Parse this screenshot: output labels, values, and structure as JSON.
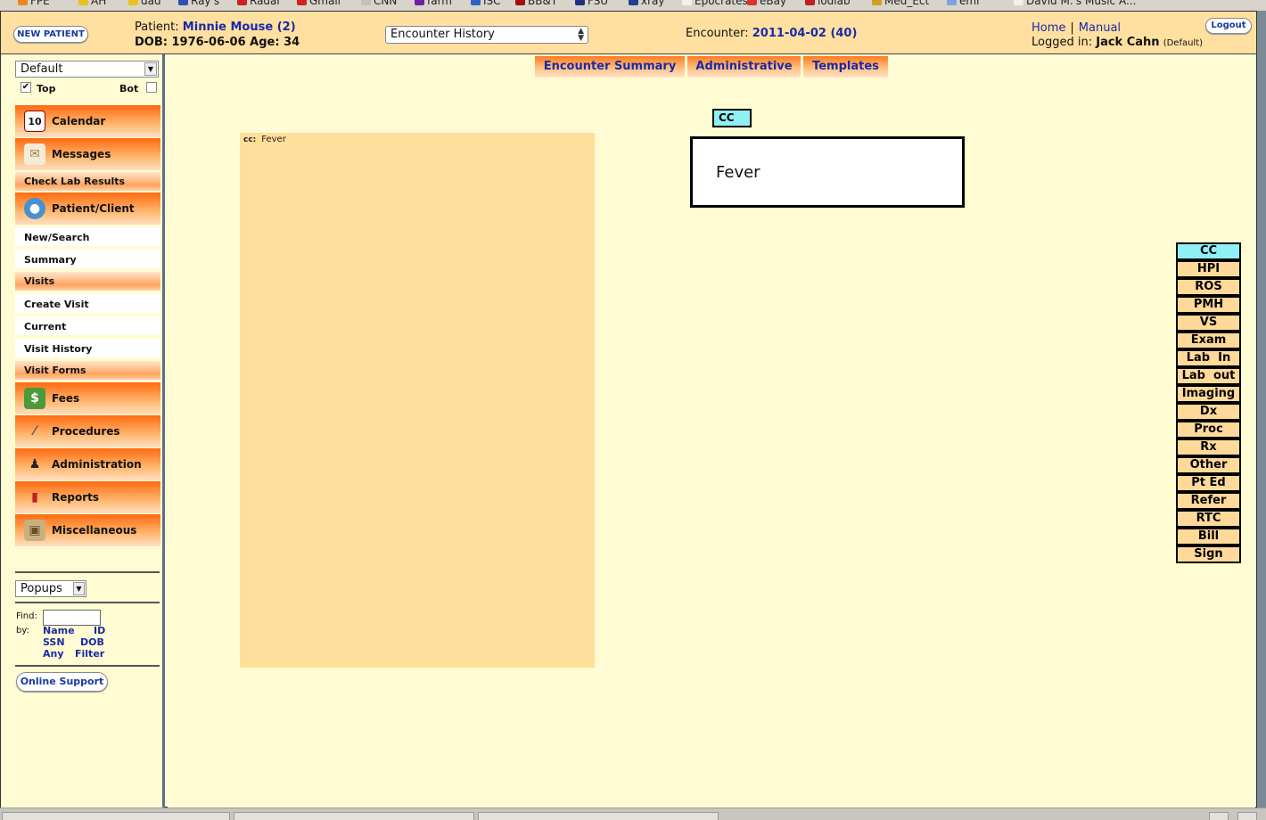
{
  "bookmarks": [
    "FPE",
    "AH",
    "dad",
    "Ray's",
    "Radar",
    "Gmail",
    "CNN",
    "farm",
    "ISC",
    "BB&T",
    "FSU",
    "xray",
    "Epocrates",
    "eBay",
    "iodlab",
    "Med_Ect",
    "emr",
    "David M.'s Music A..."
  ],
  "header": {
    "new_patient": "NEW PATIENT",
    "patient_label": "Patient:",
    "patient_name": "Minnie Mouse (2)",
    "dob_line": "DOB: 1976-06-06 Age: 34",
    "encounter_select": "Encounter History",
    "encounter_label": "Encounter:",
    "encounter_value": "2011-04-02 (40)",
    "home": "Home",
    "separator": "|",
    "manual": "Manual",
    "logged_in_label": "Logged in:",
    "user": "Jack Cahn",
    "user_role": "(Default)",
    "logout": "Logout"
  },
  "sidebar": {
    "view_select": "Default",
    "top_label": "Top",
    "top_checked": true,
    "bot_label": "Bot",
    "bot_checked": false,
    "menu": {
      "calendar": "Calendar",
      "messages": "Messages",
      "check_lab": "Check Lab Results",
      "patient_client": "Patient/Client",
      "new_search": "New/Search",
      "summary": "Summary",
      "visits": "Visits",
      "create_visit": "Create Visit",
      "current": "Current",
      "visit_history": "Visit History",
      "visit_forms": "Visit Forms",
      "fees": "Fees",
      "procedures": "Procedures",
      "administration": "Administration",
      "reports": "Reports",
      "miscellaneous": "Miscellaneous"
    },
    "popups": "Popups",
    "find_label": "Find:",
    "by_label": "by:",
    "by_links": [
      "Name",
      "ID",
      "SSN",
      "DOB",
      "Any",
      "Filter"
    ],
    "online_support": "Online Support"
  },
  "main": {
    "tabs": [
      "Encounter Summary",
      "Administrative",
      "Templates"
    ],
    "cc_panel_label": "cc:",
    "cc_panel_value": "Fever",
    "cc_tag": "CC",
    "cc_value": "Fever",
    "nav_buttons": [
      "CC",
      "HPI",
      "ROS",
      "PMH",
      "VS",
      "Exam",
      "Lab  In",
      "Lab  out",
      "Imaging",
      "Dx",
      "Proc",
      "Rx",
      "Other",
      "Pt Ed",
      "Refer",
      "RTC",
      "Bill",
      "Sign"
    ],
    "active_nav": "CC"
  },
  "colors": {
    "header_bg": "#ffe0a0",
    "content_bg": "#fffcd3",
    "link_blue": "#1a2aa8",
    "menu_orange": "#ff6a10",
    "active_cyan": "#8ff0f6"
  }
}
